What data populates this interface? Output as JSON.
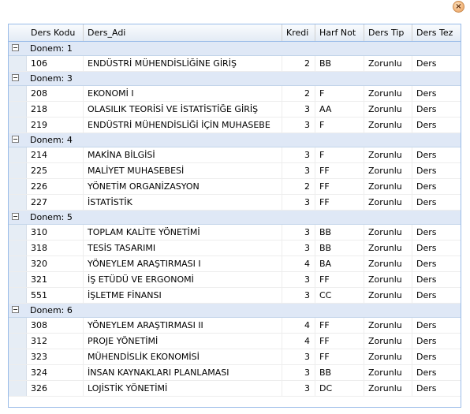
{
  "columns": [
    "Ders Kodu",
    "Ders_Adi",
    "Kredi",
    "Harf Not",
    "Ders Tip",
    "Ders Tez"
  ],
  "groups": [
    {
      "label": "Donem: 1",
      "rows": [
        [
          "106",
          "ENDÜSTRİ MÜHENDİSLİĞİNE GİRİŞ",
          "2",
          "BB",
          "Zorunlu",
          "Ders"
        ]
      ]
    },
    {
      "label": "Donem: 3",
      "rows": [
        [
          "208",
          "EKONOMİ I",
          "2",
          "F",
          "Zorunlu",
          "Ders"
        ],
        [
          "218",
          "OLASILIK TEORİSİ VE İSTATİSTİĞE GİRİŞ",
          "3",
          "AA",
          "Zorunlu",
          "Ders"
        ],
        [
          "219",
          "ENDÜSTRİ MÜHENDİSLİĞİ İÇİN MUHASEBE",
          "3",
          "F",
          "Zorunlu",
          "Ders"
        ]
      ]
    },
    {
      "label": "Donem: 4",
      "rows": [
        [
          "214",
          "MAKİNA BİLGİSİ",
          "3",
          "F",
          "Zorunlu",
          "Ders"
        ],
        [
          "225",
          "MALİYET MUHASEBESİ",
          "3",
          "FF",
          "Zorunlu",
          "Ders"
        ],
        [
          "226",
          "YÖNETİM ORGANİZASYON",
          "2",
          "FF",
          "Zorunlu",
          "Ders"
        ],
        [
          "227",
          "İSTATİSTİK",
          "3",
          "FF",
          "Zorunlu",
          "Ders"
        ]
      ]
    },
    {
      "label": "Donem: 5",
      "rows": [
        [
          "310",
          "TOPLAM KALİTE YÖNETİMİ",
          "3",
          "BB",
          "Zorunlu",
          "Ders"
        ],
        [
          "318",
          "TESİS TASARIMI",
          "3",
          "BB",
          "Zorunlu",
          "Ders"
        ],
        [
          "320",
          "YÖNEYLEM ARAŞTIRMASI I",
          "4",
          "BA",
          "Zorunlu",
          "Ders"
        ],
        [
          "321",
          "İŞ ETÜDÜ VE ERGONOMİ",
          "3",
          "FF",
          "Zorunlu",
          "Ders"
        ],
        [
          "551",
          "İŞLETME FİNANSI",
          "3",
          "CC",
          "Zorunlu",
          "Ders"
        ]
      ]
    },
    {
      "label": "Donem: 6",
      "rows": [
        [
          "308",
          "YÖNEYLEM ARAŞTIRMASI II",
          "4",
          "FF",
          "Zorunlu",
          "Ders"
        ],
        [
          "312",
          "PROJE YÖNETİMİ",
          "4",
          "FF",
          "Zorunlu",
          "Ders"
        ],
        [
          "323",
          "MÜHENDİSLİK EKONOMİSİ",
          "3",
          "FF",
          "Zorunlu",
          "Ders"
        ],
        [
          "324",
          "İNSAN KAYNAKLARI PLANLAMASI",
          "3",
          "BB",
          "Zorunlu",
          "Ders"
        ],
        [
          "326",
          "LOJİSTİK YÖNETİMİ",
          "3",
          "DC",
          "Zorunlu",
          "Ders"
        ]
      ]
    }
  ],
  "icons": {
    "close": "close-icon",
    "collapse": "collapse-toggle-icon"
  },
  "colors": {
    "header_bg": "#e3ebf5",
    "group_bg": "#dfe8f6",
    "border": "#99bbe8",
    "close_btn": "#f3b981"
  }
}
